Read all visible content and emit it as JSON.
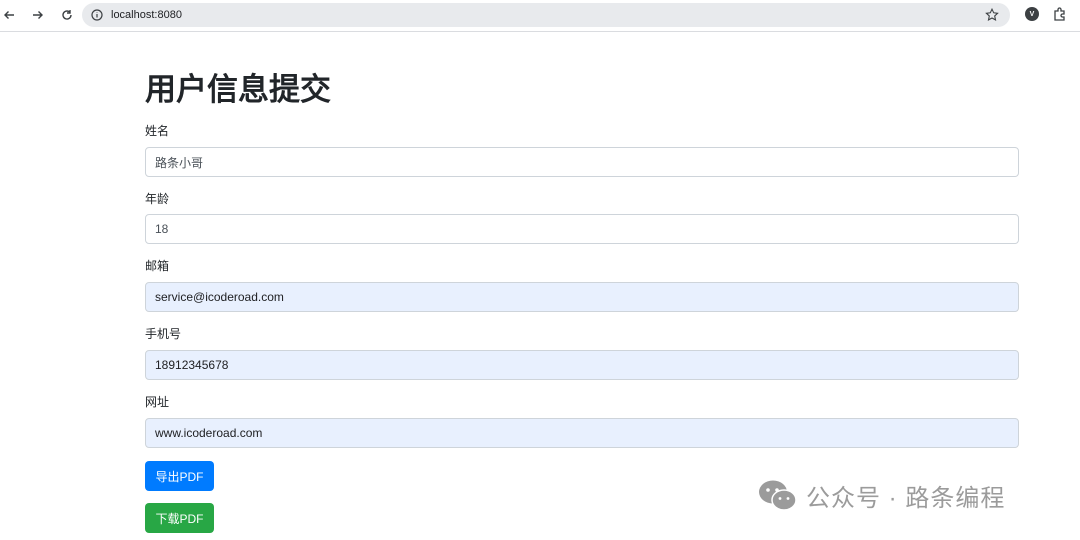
{
  "browser": {
    "url": "localhost:8080"
  },
  "page": {
    "title": "用户信息提交"
  },
  "form": {
    "fields": [
      {
        "label": "姓名",
        "value": "路条小哥",
        "autofilled": false
      },
      {
        "label": "年龄",
        "value": "18",
        "autofilled": false
      },
      {
        "label": "邮箱",
        "value": "service@icoderoad.com",
        "autofilled": true
      },
      {
        "label": "手机号",
        "value": "18912345678",
        "autofilled": true
      },
      {
        "label": "网址",
        "value": "www.icoderoad.com",
        "autofilled": true
      }
    ],
    "export_button": "导出PDF",
    "download_button": "下载PDF"
  },
  "watermark": {
    "text": "公众号 · 路条编程"
  },
  "colors": {
    "primary": "#007bff",
    "success": "#28a745",
    "autofill_bg": "#e8f0fe"
  }
}
